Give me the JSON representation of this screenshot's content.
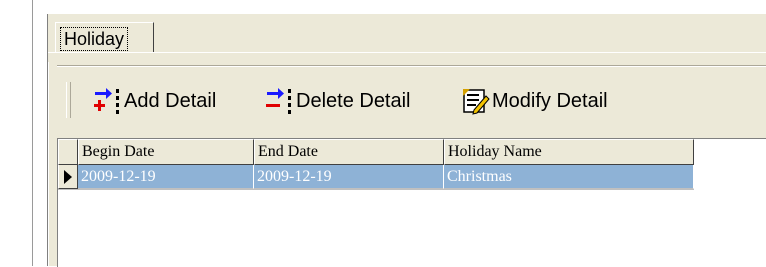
{
  "tabs": [
    {
      "label": "Holiday",
      "selected": true
    }
  ],
  "toolbar": {
    "add_label": "Add Detail",
    "add_icon": "add-detail-icon",
    "delete_label": "Delete Detail",
    "delete_icon": "delete-detail-icon",
    "modify_label": "Modify Detail",
    "modify_icon": "modify-detail-icon"
  },
  "grid": {
    "columns": [
      "Begin Date",
      "End Date",
      "Holiday Name"
    ],
    "rows": [
      {
        "begin_date": "2009-12-19",
        "end_date": "2009-12-19",
        "holiday_name": "Christmas",
        "selected": true
      }
    ]
  },
  "colors": {
    "panel": "#ece9d8",
    "selection": "#8eb2d6",
    "selection_text": "#ffffff"
  }
}
